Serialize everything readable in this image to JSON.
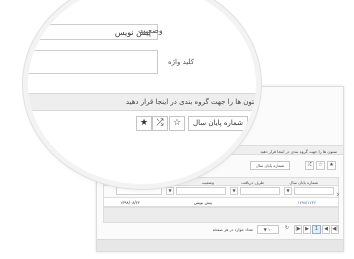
{
  "form": {
    "status_label": "وضعیت",
    "status_value": "پیش نویس",
    "status_caret": "▼",
    "keyword_label": "کلید واژه"
  },
  "grouping": {
    "hint": "ستون ها را جهت گروه بندی در اینجا قرار دهید"
  },
  "toolbar": {
    "year_filter": "شماره پایان سال",
    "star_filled": "★",
    "star_outline": "☆",
    "shuffle": "⤮"
  },
  "table": {
    "headers": [
      "شماره پایان سال",
      "طرف دریافت",
      "وضعیت",
      "تاریخ ارتباط"
    ],
    "filter_icon": "▼",
    "rows": [
      {
        "number": "۱۲۹۸/۱۲۳۶",
        "party": "",
        "status": "پیش نویس",
        "date": "۱۳۹۸/۰۸/۲۲"
      }
    ]
  },
  "pager": {
    "page_size": "۱۰",
    "page_size_caret": "▼",
    "page_size_label": "تعداد موارد در هر صفحه",
    "current_page": "1",
    "first": "|◀",
    "prev": "◀",
    "next": "▶",
    "last": "▶|",
    "refresh": "↻"
  },
  "nav": {
    "right_arrow": "›",
    "left_arrow": "‹"
  }
}
